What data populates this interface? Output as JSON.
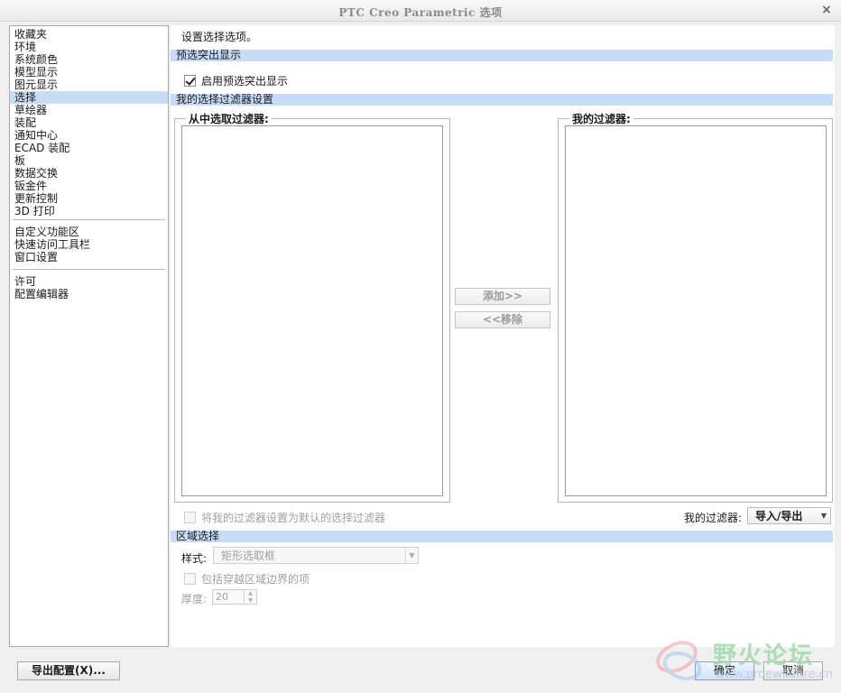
{
  "window": {
    "title": "PTC Creo Parametric 选项",
    "close_glyph": "×"
  },
  "nav": {
    "group1": [
      "收藏夹",
      "环境",
      "系统颜色",
      "模型显示",
      "图元显示",
      "选择",
      "草绘器",
      "装配",
      "通知中心",
      "ECAD 装配",
      "板",
      "数据交换",
      "钣金件",
      "更新控制",
      "3D 打印"
    ],
    "group2": [
      "自定义功能区",
      "快速访问工具栏",
      "窗口设置"
    ],
    "group3": [
      "许可",
      "配置编辑器"
    ],
    "selected": "选择"
  },
  "main": {
    "intro": "设置选择选项。",
    "section_preselect": "预选突出显示",
    "enable_preselect_label": "启用预选突出显示",
    "enable_preselect_checked": true,
    "section_filters": "我的选择过滤器设置",
    "available_filters_legend": "从中选取过滤器:",
    "my_filters_legend": "我的过滤器:",
    "add_button": "添加>>",
    "remove_button": "<<移除",
    "set_default_label": "将我的过滤器设置为默认的选择过滤器",
    "my_filters_label": "我的过滤器:",
    "import_export": "导入/导出",
    "section_region": "区域选择",
    "style_label": "样式:",
    "style_value": "矩形选取框",
    "include_crossing_label": "包括穿越区域边界的项",
    "thickness_label": "厚度:",
    "thickness_value": "20"
  },
  "footer": {
    "export_config": "导出配置(X)...",
    "ok": "确定",
    "cancel": "取消"
  },
  "watermark": {
    "title": "野火论坛",
    "url": "www.proewildfire.cn"
  },
  "colors": {
    "section_bar": "#c7dcf7",
    "nav_selected": "#c8dcf8"
  }
}
